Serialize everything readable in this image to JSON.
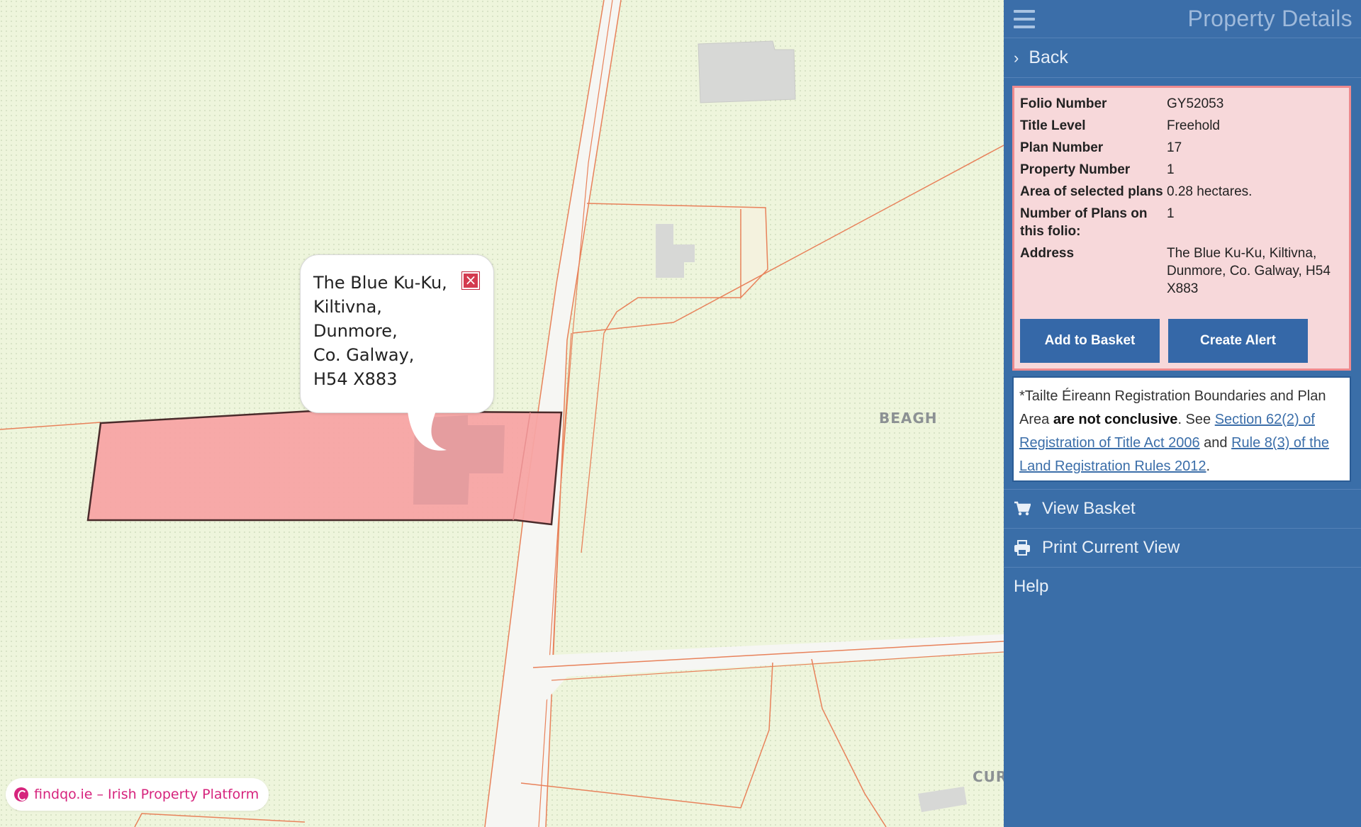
{
  "map": {
    "popup": {
      "lines": [
        "The Blue Ku-Ku,",
        "Kiltivna,",
        "Dunmore,",
        "Co. Galway,",
        "H54 X883"
      ]
    },
    "townland_labels": [
      "BEAGH",
      "CUR"
    ],
    "attribution": "findqo.ie – Irish Property Platform",
    "colors": {
      "background": "#eef5dc",
      "boundary": "#e8815a",
      "selected_parcel": "#f7a4a4",
      "building": "#d7d8d6",
      "road": "#f6f6f3"
    }
  },
  "panel": {
    "title": "Property Details",
    "back_label": "Back",
    "details": [
      {
        "label": "Folio Number",
        "value": "GY52053"
      },
      {
        "label": "Title Level",
        "value": "Freehold"
      },
      {
        "label": "Plan Number",
        "value": "17"
      },
      {
        "label": "Property Number",
        "value": "1"
      },
      {
        "label": "Area of selected plans",
        "value": "0.28 hectares."
      },
      {
        "label": "Number of Plans on this folio:",
        "value": "1"
      },
      {
        "label": "Address",
        "value": "The Blue Ku-Ku, Kiltivna, Dunmore, Co. Galway, H54 X883"
      }
    ],
    "buttons": {
      "add_to_basket": "Add to Basket",
      "create_alert": "Create Alert"
    },
    "disclaimer": {
      "intro": "*Tailte Éireann Registration Boundaries and Plan Area",
      "bold": "are not conclusive",
      "see": ". See",
      "link1": "Section 62(2) of Registration of Title Act 2006",
      "and": "and",
      "link2": "Rule 8(3) of the Land Registration Rules 2012",
      "end": "."
    },
    "menu": {
      "view_basket": "View Basket",
      "print_current_view": "Print Current View",
      "help": "Help"
    },
    "colors": {
      "panel_bg": "#3a6ea8",
      "details_bg": "#f7d8da",
      "details_border": "#ee8a8e",
      "button_bg": "#3568a8"
    }
  }
}
